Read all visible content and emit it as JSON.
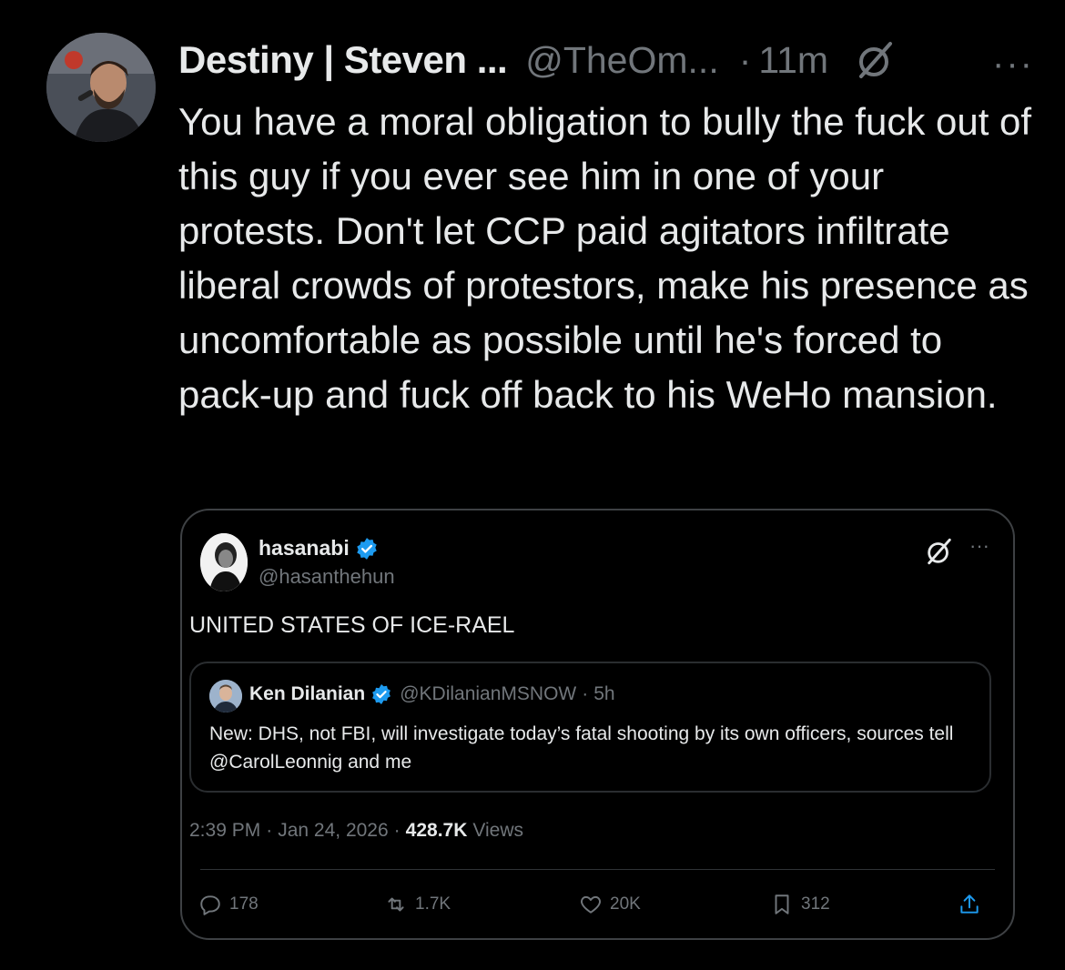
{
  "tweet": {
    "display_name": "Destiny | Steven ...",
    "handle": "@TheOm...",
    "dot": "·",
    "time": "11m",
    "more": "···",
    "text": "You have a moral obligation to bully the fuck out of this guy if you ever see him in one of your protests. Don't let CCP paid agitators infiltrate liberal crowds of protestors, make his presence as uncomfortable as possible until he's forced to pack-up and fuck off back to his WeHo mansion."
  },
  "quote": {
    "display_name": "hasanabi",
    "handle": "@hasanthehun",
    "more": "···",
    "text": "UNITED STATES OF ICE-RAEL",
    "nested": {
      "display_name": "Ken Dilanian",
      "handle": "@KDilanianMSNOW",
      "dot": "·",
      "time": "5h",
      "text": "New: DHS, not FBI, will investigate today’s fatal shooting by its own officers, sources tell @CarolLeonnig and me"
    },
    "meta": {
      "time": "2:39 PM",
      "sep": "·",
      "date": "Jan 24, 2026",
      "views_count": "428.7K",
      "views_label": "Views"
    },
    "actions": {
      "replies": "178",
      "reposts": "1.7K",
      "likes": "20K",
      "bookmarks": "312"
    }
  },
  "colors": {
    "background": "#000000",
    "text_primary": "#e7e9ea",
    "text_secondary": "#71767b",
    "verified": "#1d9bf0",
    "border": "#3e4144"
  },
  "icons": [
    "grok-icon",
    "more-icon",
    "verified-icon",
    "reply-icon",
    "repost-icon",
    "like-icon",
    "bookmark-icon",
    "share-icon"
  ]
}
